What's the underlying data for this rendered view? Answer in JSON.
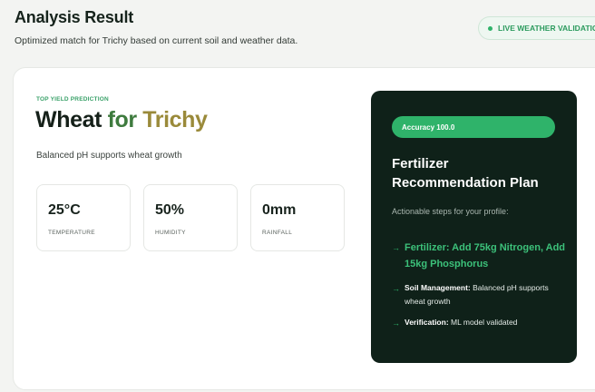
{
  "header": {
    "title": "Analysis Result",
    "subtitle": "Optimized match for Trichy based on current soil and weather data.",
    "badge": "LIVE WEATHER VALIDATION"
  },
  "prediction": {
    "eyebrow": "TOP YIELD PREDICTION",
    "crop": "Wheat",
    "connector": "for",
    "location": "Trichy",
    "reason": "Balanced pH supports wheat growth"
  },
  "stats": [
    {
      "value": "25°C",
      "label": "TEMPERATURE"
    },
    {
      "value": "50%",
      "label": "HUMIDITY"
    },
    {
      "value": "0mm",
      "label": "RAINFALL"
    }
  ],
  "plan": {
    "accuracy": "Accuracy 100.0",
    "title": "Fertilizer Recommendation Plan",
    "subtitle": "Actionable steps for your profile:",
    "arrow": "→",
    "steps": [
      {
        "key": "",
        "text": "Fertilizer: Add 75kg Nitrogen, Add 15kg Phosphorus"
      },
      {
        "key": "Soil Management:",
        "text": " Balanced pH supports wheat growth"
      },
      {
        "key": "Verification:",
        "text": " ML model validated"
      }
    ]
  },
  "colors": {
    "accent": "#2fb36a",
    "panel": "#0f2119",
    "crop_for": "#3e7b3e",
    "crop_location": "#9a8a3a"
  }
}
